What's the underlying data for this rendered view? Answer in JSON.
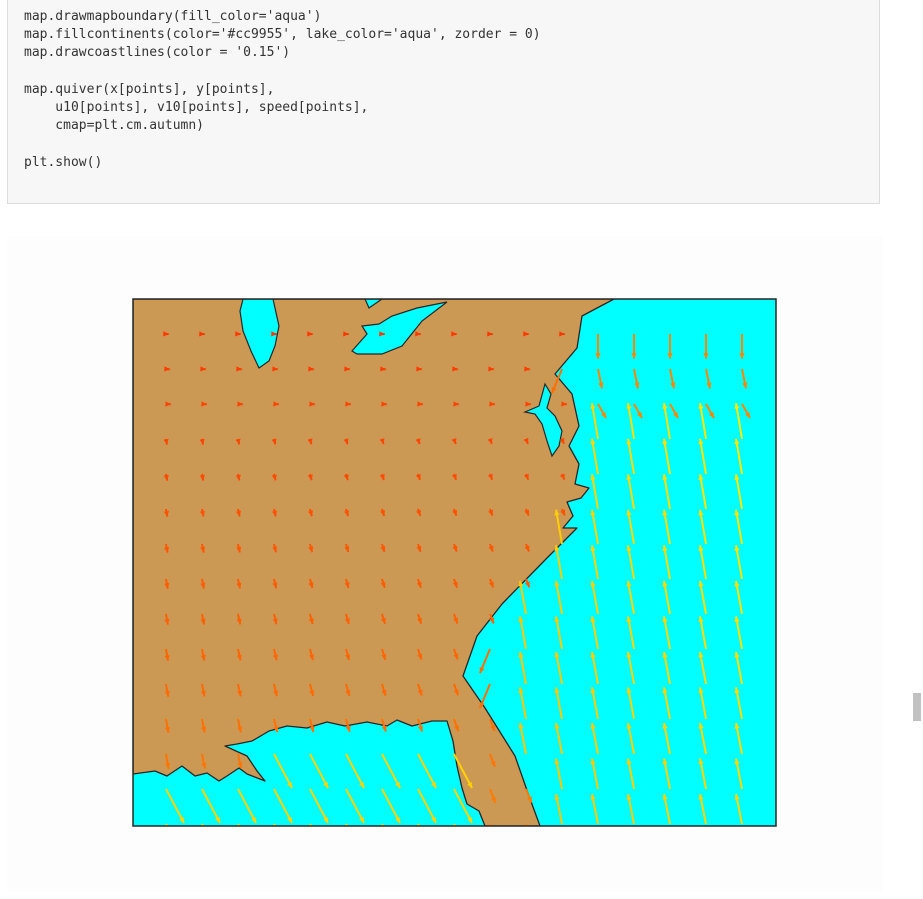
{
  "code_cell": {
    "lines": [
      "map.drawmapboundary(fill_color='aqua')",
      "map.fillcontinents(color='#cc9955', lake_color='aqua', zorder = 0)",
      "map.drawcoastlines(color = '0.15')",
      "",
      "map.quiver(x[points], y[points],",
      "    u10[points], v10[points], speed[points],",
      "    cmap=plt.cm.autumn)",
      "",
      "plt.show()"
    ]
  },
  "figure": {
    "ocean_color": "#00ffff",
    "land_color": "#cc9955",
    "coastline_color": "#262626",
    "colormap": "autumn",
    "arrow_color_low": "#ff2000",
    "arrow_color_high": "#ffff00"
  },
  "scrollbar": {
    "thumb_color": "#c1c1c1"
  }
}
